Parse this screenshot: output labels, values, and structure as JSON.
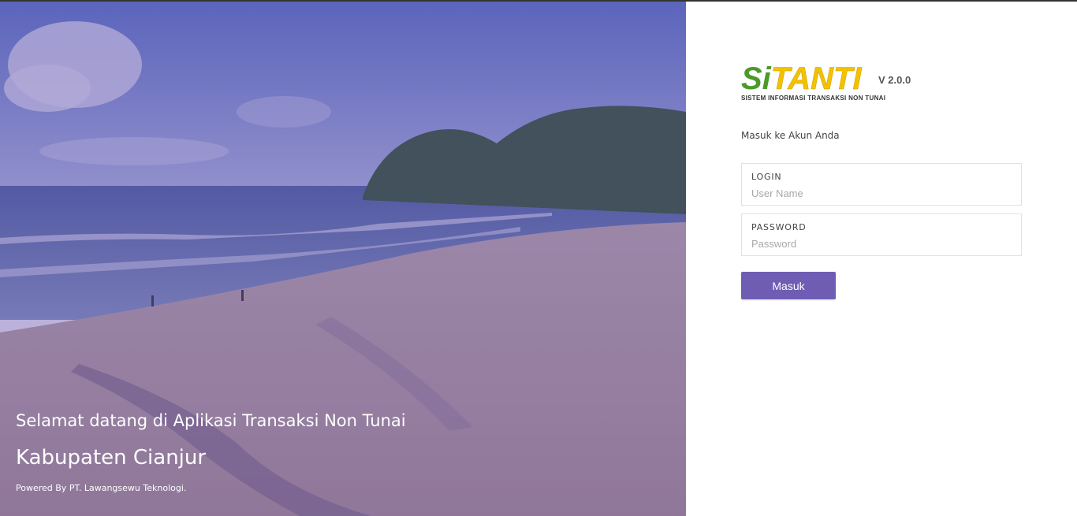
{
  "hero": {
    "welcome_text": "Selamat datang di Aplikasi Transaksi Non Tunai",
    "region_text": "Kabupaten Cianjur",
    "powered_text": "Powered By PT. Lawangsewu Teknologi.",
    "image_subject": "beach-landscape-photo"
  },
  "logo": {
    "si": "Si",
    "tanti": "TANTI",
    "version": "V 2.0.0",
    "tagline": "SISTEM INFORMASI TRANSAKSI NON TUNAI"
  },
  "login_form": {
    "subtitle": "Masuk ke Akun Anda",
    "login_label": "LOGIN",
    "login_placeholder": "User Name",
    "password_label": "PASSWORD",
    "password_placeholder": "Password",
    "submit_label": "Masuk"
  },
  "colors": {
    "accent": "#6e5db3",
    "overlay": "#5c46aa",
    "logo_green": "#4c9a2a",
    "logo_yellow": "#f2c200"
  }
}
